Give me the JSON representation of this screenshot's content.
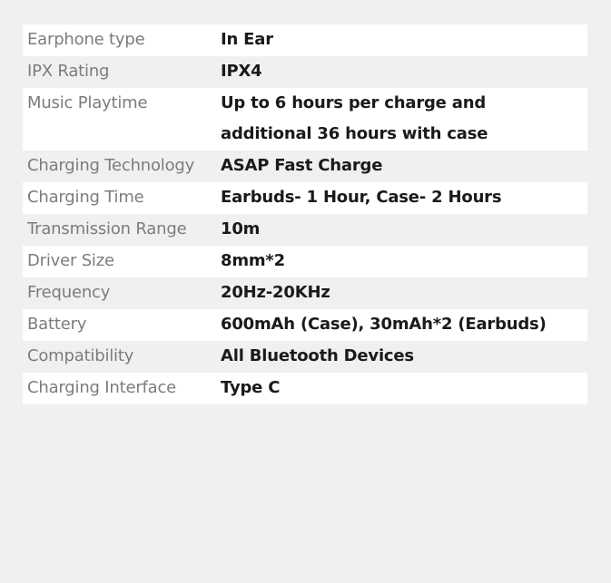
{
  "specs": {
    "rows": [
      {
        "label": "Earphone type",
        "value": "In Ear"
      },
      {
        "label": "IPX Rating",
        "value": "IPX4"
      },
      {
        "label": "Music Playtime",
        "value": "Up to 6 hours per charge and additional 36 hours with case"
      },
      {
        "label": "Charging Technology",
        "value": "ASAP Fast Charge"
      },
      {
        "label": "Charging Time",
        "value": "Earbuds- 1 Hour, Case- 2 Hours"
      },
      {
        "label": "Transmission Range",
        "value": "10m"
      },
      {
        "label": "Driver Size",
        "value": "8mm*2"
      },
      {
        "label": "Frequency",
        "value": "20Hz-20KHz"
      },
      {
        "label": "Battery",
        "value": "600mAh (Case), 30mAh*2 (Earbuds)"
      },
      {
        "label": "Compatibility",
        "value": "All Bluetooth Devices"
      },
      {
        "label": "Charging Interface",
        "value": "Type C"
      }
    ]
  }
}
